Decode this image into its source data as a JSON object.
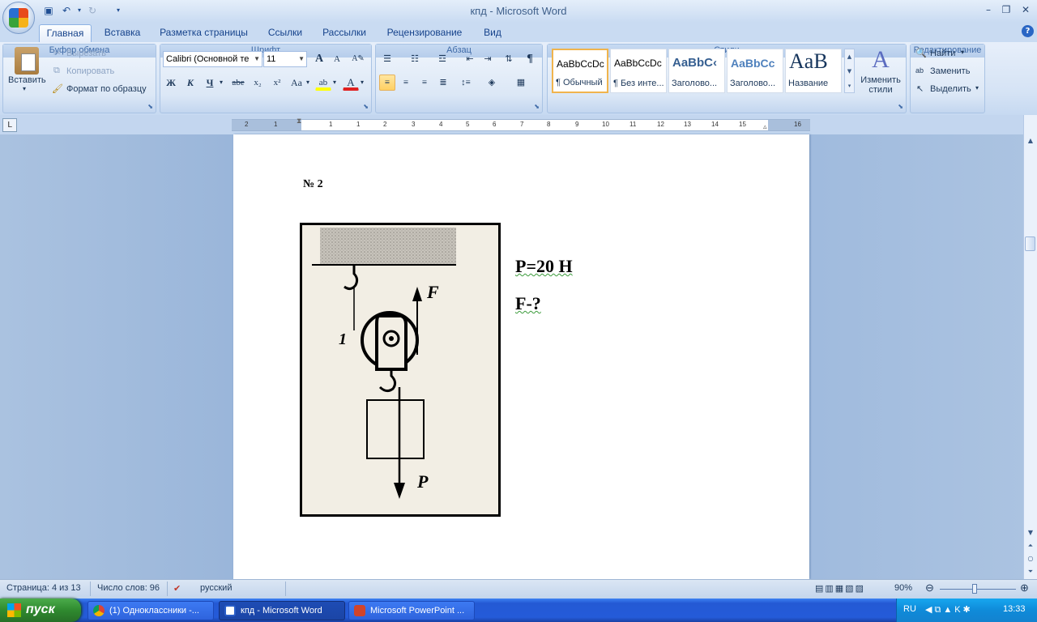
{
  "window": {
    "title": "кпд - Microsoft Word"
  },
  "tabs": [
    "Главная",
    "Вставка",
    "Разметка страницы",
    "Ссылки",
    "Рассылки",
    "Рецензирование",
    "Вид"
  ],
  "clipboard": {
    "paste": "Вставить",
    "cut": "Вырезать",
    "copy": "Копировать",
    "format_painter": "Формат по образцу",
    "group": "Буфер обмена"
  },
  "font": {
    "name": "Calibri (Основной те",
    "size": "11",
    "group": "Шрифт",
    "bold": "Ж",
    "italic": "К",
    "underline": "Ч",
    "strike": "abe",
    "sub": "x₂",
    "sup": "x²",
    "case": "Aa",
    "grow": "A",
    "shrink": "A",
    "highlight": "ab",
    "color": "A"
  },
  "paragraph": {
    "group": "Абзац",
    "pilcrow": "¶"
  },
  "styles": {
    "group": "Стили",
    "change": "Изменить стили",
    "tiles": [
      {
        "sample": "AaBbCcDc",
        "name": "¶ Обычный"
      },
      {
        "sample": "AaBbCcDc",
        "name": "¶ Без инте..."
      },
      {
        "sample": "AaBbC‹",
        "name": "Заголово..."
      },
      {
        "sample": "AaBbCc",
        "name": "Заголово..."
      },
      {
        "sample": "AaB",
        "name": "Название"
      }
    ]
  },
  "editing": {
    "group": "Редактирование",
    "find": "Найти",
    "replace": "Заменить",
    "select": "Выделить"
  },
  "ruler": {
    "labels": [
      "2",
      "1",
      "1",
      "1",
      "2",
      "3",
      "4",
      "5",
      "6",
      "7",
      "8",
      "9",
      "10",
      "11",
      "12",
      "13",
      "14",
      "15",
      "16",
      "18"
    ]
  },
  "document": {
    "heading": "№ 2",
    "given1": "Р=20 Н",
    "given2": "F-?",
    "figure": {
      "label_f": "F",
      "label_p": "P",
      "label_1": "1"
    }
  },
  "status": {
    "page": "Страница: 4 из 13",
    "words": "Число слов: 96",
    "lang": "русский",
    "zoom": "90%"
  },
  "taskbar": {
    "start": "пуск",
    "items": [
      {
        "label": "(1) Одноклассники -...",
        "color": "#e8a21a"
      },
      {
        "label": "кпд - Microsoft Word",
        "color": "#2b5ec7"
      },
      {
        "label": "Microsoft PowerPoint ...",
        "color": "#d2442a"
      }
    ],
    "lang": "RU",
    "time": "13:33"
  }
}
